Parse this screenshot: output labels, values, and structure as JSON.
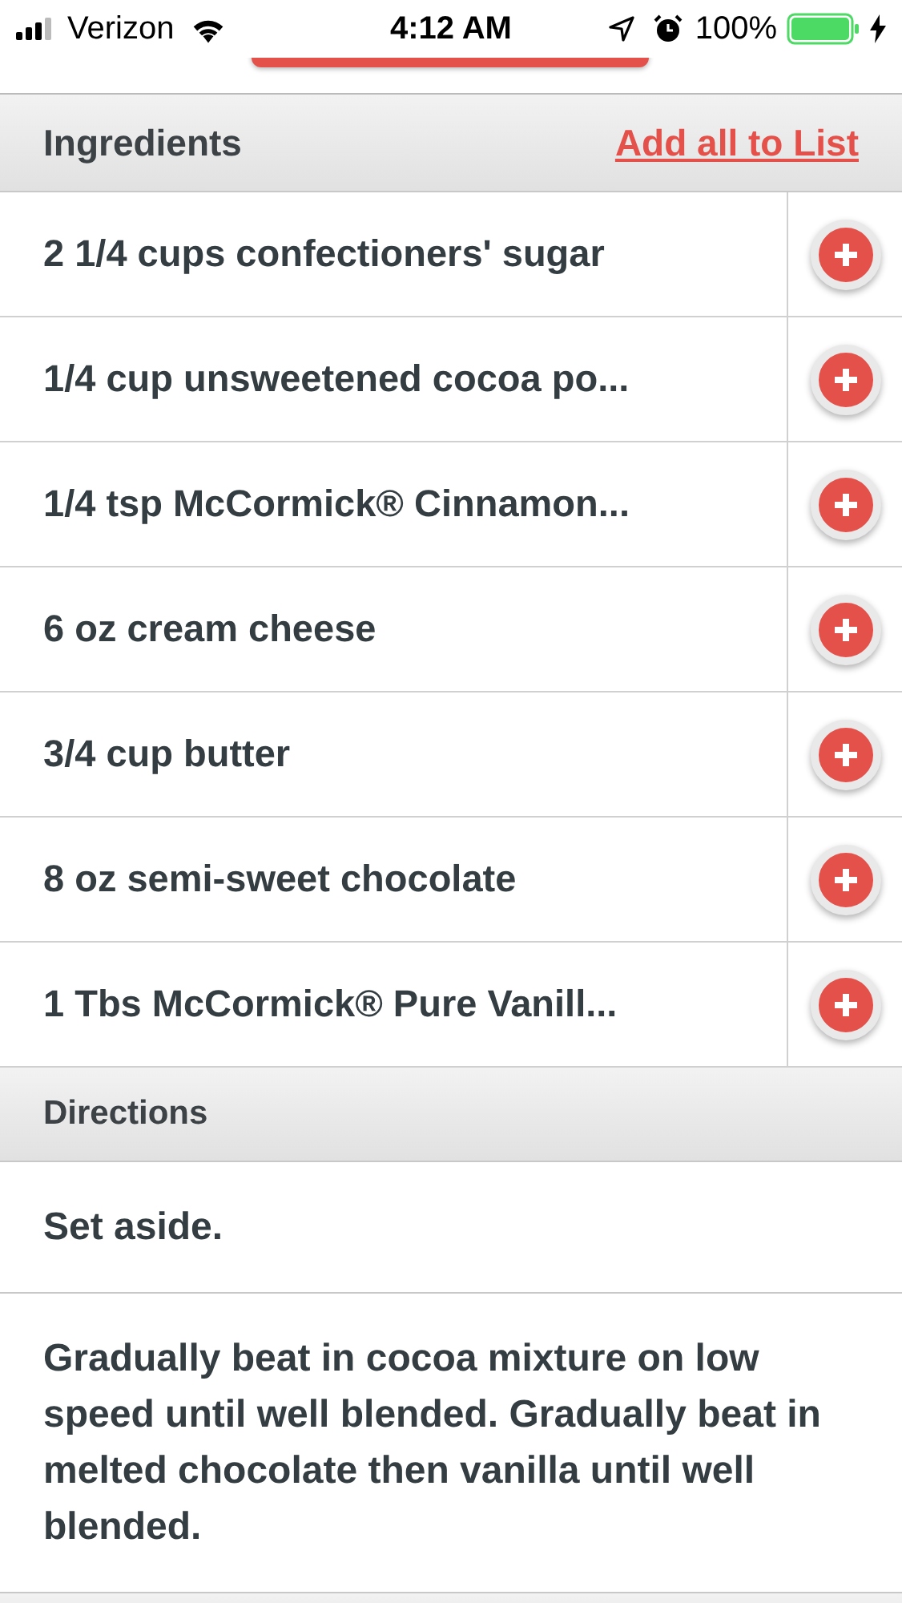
{
  "status_bar": {
    "carrier": "Verizon",
    "time": "4:12 AM",
    "battery": "100%"
  },
  "ingredients": {
    "title": "Ingredients",
    "action": "Add all to List",
    "items": [
      {
        "text": "2 1/4 cups confectioners' sugar"
      },
      {
        "text": "1/4 cup unsweetened cocoa po..."
      },
      {
        "text": "1/4 tsp McCormick® Cinnamon..."
      },
      {
        "text": "6 oz cream cheese"
      },
      {
        "text": "3/4 cup butter"
      },
      {
        "text": "8 oz semi-sweet chocolate"
      },
      {
        "text": "1 Tbs McCormick® Pure Vanill..."
      }
    ]
  },
  "directions": {
    "title": "Directions",
    "steps": [
      "Set aside.",
      "Gradually beat in cocoa mixture on low speed until well blended. Gradually beat in melted chocolate then vanilla until well blended."
    ]
  }
}
